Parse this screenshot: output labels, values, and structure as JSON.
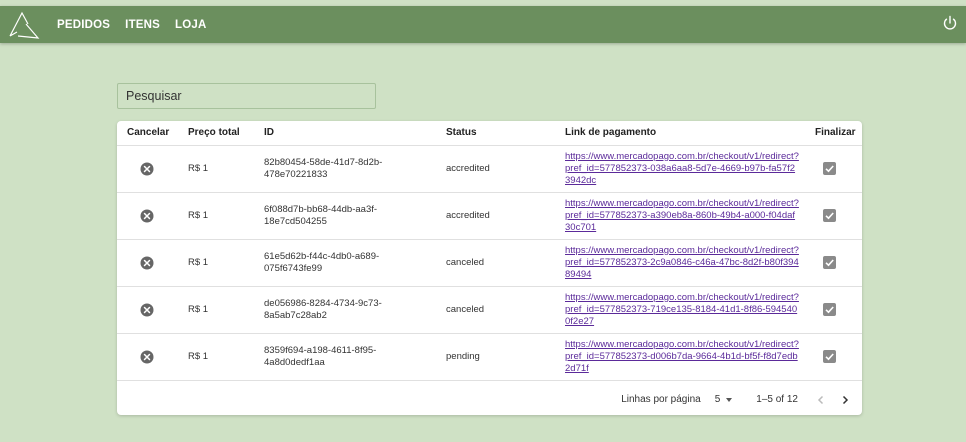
{
  "nav": {
    "items": [
      "PEDIDOS",
      "ITENS",
      "LOJA"
    ]
  },
  "search": {
    "placeholder": "Pesquisar"
  },
  "table": {
    "headers": [
      "Cancelar",
      "Preço total",
      "ID",
      "Status",
      "Link de pagamento",
      "Finalizar"
    ],
    "rows": [
      {
        "price": "R$ 1",
        "id": "82b80454-58de-41d7-8d2b-478e70221833",
        "status": "accredited",
        "link": "https://www.mercadopago.com.br/checkout/v1/redirect?pref_id=577852373-038a6aa8-5d7e-4669-b97b-fa57f23942dc"
      },
      {
        "price": "R$ 1",
        "id": "6f088d7b-bb68-44db-aa3f-18e7cd504255",
        "status": "accredited",
        "link": "https://www.mercadopago.com.br/checkout/v1/redirect?pref_id=577852373-a390eb8a-860b-49b4-a000-f04daf30c701"
      },
      {
        "price": "R$ 1",
        "id": "61e5d62b-f44c-4db0-a689-075f6743fe99",
        "status": "canceled",
        "link": "https://www.mercadopago.com.br/checkout/v1/redirect?pref_id=577852373-2c9a0846-c46a-47bc-8d2f-b80f39489494"
      },
      {
        "price": "R$ 1",
        "id": "de056986-8284-4734-9c73-8a5ab7c28ab2",
        "status": "canceled",
        "link": "https://www.mercadopago.com.br/checkout/v1/redirect?pref_id=577852373-719ce135-8184-41d1-8f86-5945400f2e27"
      },
      {
        "price": "R$ 1",
        "id": "8359f694-a198-4611-8f95-4a8d0dedf1aa",
        "status": "pending",
        "link": "https://www.mercadopago.com.br/checkout/v1/redirect?pref_id=577852373-d006b7da-9664-4b1d-bf5f-f8d7edb2d71f"
      }
    ]
  },
  "pagination": {
    "rows_per_page_label": "Linhas por página",
    "rows_per_page": "5",
    "range": "1–5 of 12"
  },
  "colors": {
    "appbar": "#6b8f5e",
    "background": "#cfe1c5",
    "link": "#5b2a9a"
  },
  "icons": [
    "logo-icon",
    "power-icon",
    "cancel-icon",
    "checkbox-checked-icon",
    "chevron-left-icon",
    "chevron-right-icon"
  ]
}
